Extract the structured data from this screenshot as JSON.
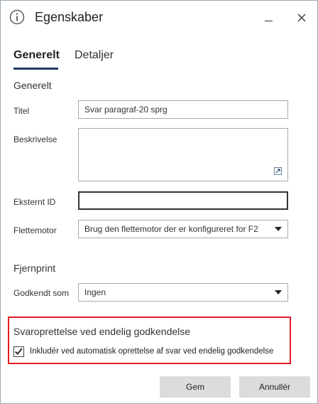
{
  "window": {
    "title": "Egenskaber",
    "info_icon": "info-circle-icon",
    "minimize_icon": "minimize-icon",
    "close_icon": "close-icon"
  },
  "tabs": [
    {
      "label": "Generelt",
      "active": true
    },
    {
      "label": "Detaljer",
      "active": false
    }
  ],
  "general_section": {
    "heading": "Generelt",
    "title_label": "Titel",
    "title_value": "Svar paragraf-20 sprg",
    "description_label": "Beskrivelse",
    "description_value": "",
    "external_id_label": "Eksternt ID",
    "external_id_value": "",
    "merge_engine_label": "Flettemotor",
    "merge_engine_value": "Brug den flettemotor der er konfigureret for F2"
  },
  "remote_print": {
    "heading": "Fjernprint",
    "approved_as_label": "Godkendt som",
    "approved_as_value": "Ingen"
  },
  "reply_creation": {
    "heading": "Svaroprettelse ved endelig godkendelse",
    "checkbox_label": "Inkludér ved automatisk oprettelse af svar ved endelig godkendelse",
    "checked": true
  },
  "buttons": {
    "save": "Gem",
    "cancel": "Annullér"
  },
  "colors": {
    "highlight": "#e31b23",
    "tab_underline": "#1e3a5c",
    "button_bg": "#dcdcdc"
  }
}
